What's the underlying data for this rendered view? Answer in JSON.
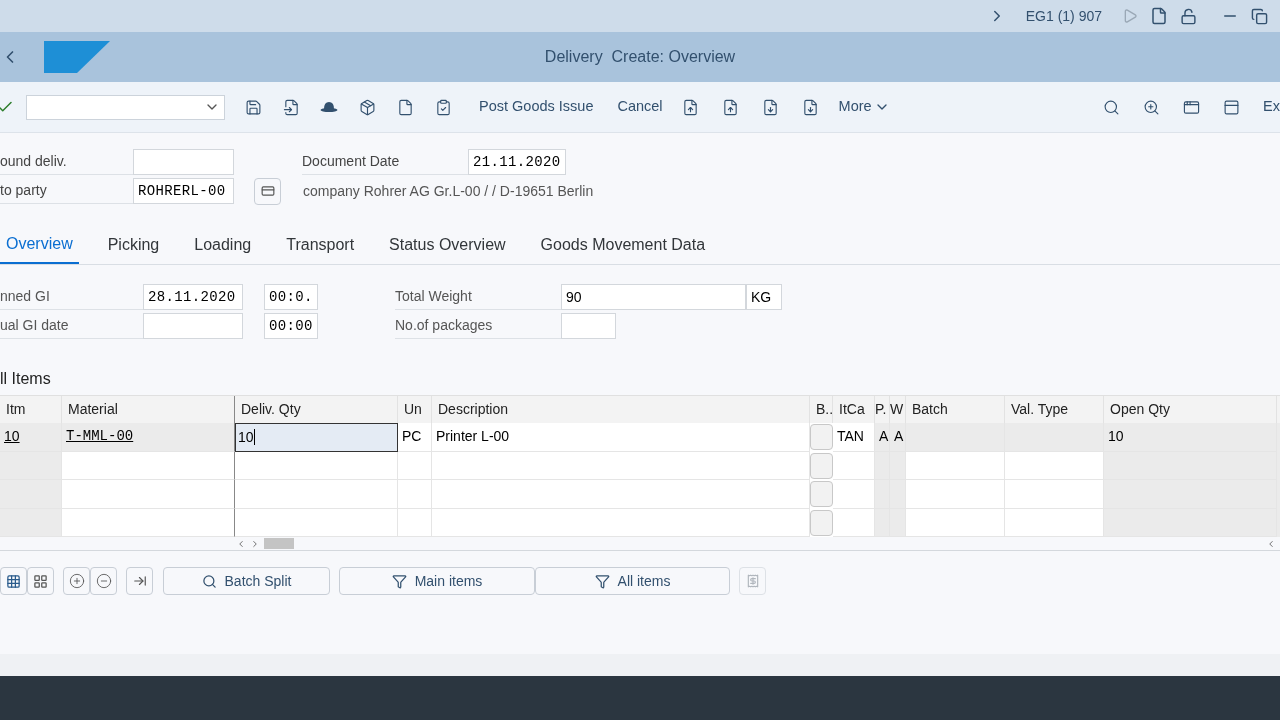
{
  "system_bar": {
    "session": "EG1 (1) 907"
  },
  "window": {
    "title": "Delivery  Create: Overview"
  },
  "toolbar": {
    "buttons": [
      "Post Goods Issue",
      "Cancel"
    ],
    "more": "More",
    "cut_button": "Ex"
  },
  "header_fields": [
    {
      "label": "ound deliv."
    },
    {
      "label": "Document Date",
      "value": "21.11.2020"
    },
    {
      "label": "to party",
      "value": "ROHRERL-00"
    },
    {
      "label": "company Rohrer AG Gr.L-00 / / D-19651 Berlin"
    }
  ],
  "tabs": [
    {
      "label": "Overview",
      "selected": true
    },
    {
      "label": "Picking",
      "selected": false
    },
    {
      "label": "Loading",
      "selected": false
    },
    {
      "label": "Transport",
      "selected": false
    },
    {
      "label": "Status Overview",
      "selected": false
    },
    {
      "label": "Goods Movement Data",
      "selected": false
    }
  ],
  "tab_fields": [
    {
      "label": "nned GI",
      "date": "28.11.2020",
      "time": "00:0.",
      "right_label": "Total Weight",
      "right_value": "90",
      "unit": "KG"
    },
    {
      "label": "ual GI date",
      "time": "00:00",
      "right_label": "No.of packages"
    }
  ],
  "section_title": "ll Items",
  "table": {
    "columns": [
      "Itm",
      "Material",
      "Deliv. Qty",
      "Un",
      "Description",
      "B..",
      "ItCa",
      "P.",
      "W",
      "Batch",
      "Val. Type",
      "Open Qty"
    ],
    "rows": [
      {
        "cells": [
          {
            "kind": "link",
            "text": "10",
            "editable": false
          },
          {
            "kind": "link",
            "text": "T-MML-00",
            "editable": false
          },
          {
            "kind": "input",
            "text": "10",
            "editable": true
          },
          {
            "kind": "text",
            "text": "PC",
            "editable": true
          },
          {
            "kind": "text",
            "text": "Printer L-00",
            "editable": true
          },
          {
            "kind": "button"
          },
          {
            "kind": "text",
            "text": "TAN",
            "editable": true
          },
          {
            "kind": "text",
            "text": "A",
            "editable": false
          },
          {
            "kind": "text",
            "text": "A",
            "editable": false
          },
          {
            "kind": "text",
            "editable": false
          },
          {
            "kind": "text",
            "editable": false
          },
          {
            "kind": "text",
            "text": "10",
            "editable": false
          }
        ]
      },
      {
        "cells": [
          {
            "kind": "text",
            "editable": false
          },
          {
            "kind": "text",
            "editable": true
          },
          {
            "kind": "text",
            "editable": true
          },
          {
            "kind": "text",
            "editable": true
          },
          {
            "kind": "text",
            "editable": true
          },
          {
            "kind": "button"
          },
          {
            "kind": "text",
            "editable": true
          },
          {
            "kind": "text",
            "editable": false
          },
          {
            "kind": "text",
            "editable": false
          },
          {
            "kind": "text",
            "editable": true
          },
          {
            "kind": "text",
            "editable": true
          },
          {
            "kind": "text",
            "editable": false
          }
        ]
      },
      {
        "cells": [
          {
            "kind": "text",
            "editable": false
          },
          {
            "kind": "text",
            "editable": true
          },
          {
            "kind": "text",
            "editable": true
          },
          {
            "kind": "text",
            "editable": true
          },
          {
            "kind": "text",
            "editable": true
          },
          {
            "kind": "button"
          },
          {
            "kind": "text",
            "editable": true
          },
          {
            "kind": "text",
            "editable": false
          },
          {
            "kind": "text",
            "editable": false
          },
          {
            "kind": "text",
            "editable": true
          },
          {
            "kind": "text",
            "editable": true
          },
          {
            "kind": "text",
            "editable": false
          }
        ]
      },
      {
        "cells": [
          {
            "kind": "text",
            "editable": false
          },
          {
            "kind": "text",
            "editable": true
          },
          {
            "kind": "text",
            "editable": true
          },
          {
            "kind": "text",
            "editable": true
          },
          {
            "kind": "text",
            "editable": true
          },
          {
            "kind": "button"
          },
          {
            "kind": "text",
            "editable": true
          },
          {
            "kind": "text",
            "editable": false
          },
          {
            "kind": "text",
            "editable": false
          },
          {
            "kind": "text",
            "editable": true
          },
          {
            "kind": "text",
            "editable": true
          },
          {
            "kind": "text",
            "editable": false
          }
        ]
      }
    ]
  },
  "bottom_buttons": [
    "Batch Split",
    "Main items",
    "All items"
  ]
}
